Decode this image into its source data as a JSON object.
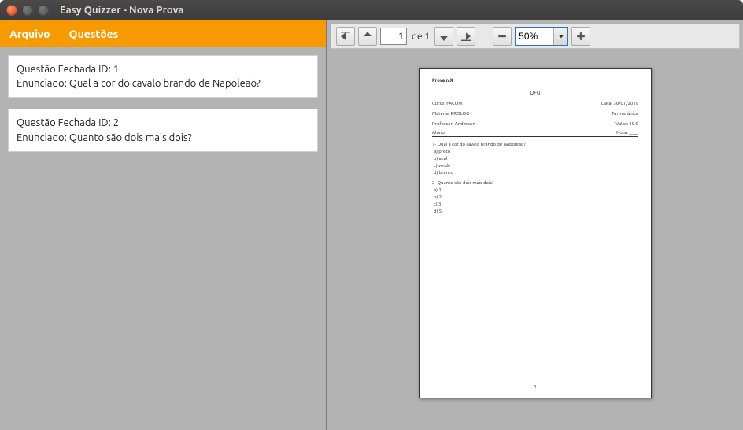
{
  "window": {
    "title": "Easy Quizzer - Nova Prova"
  },
  "menubar": {
    "arquivo": "Arquivo",
    "questoes": "Questões"
  },
  "questions": [
    {
      "id_line": "Questão Fechada ID: 1",
      "enun_line": "Enunciado: Qual a cor do cavalo brando de Napoleão?"
    },
    {
      "id_line": "Questão Fechada ID: 2",
      "enun_line": "Enunciado: Quanto são dois mais dois?"
    }
  ],
  "toolbar": {
    "page_value": "1",
    "page_of": "de 1",
    "zoom_value": "50%"
  },
  "preview": {
    "top_label": "Prova n.X",
    "university": "UFU",
    "curso": "Curso: FACOM",
    "data": "Data: 30/07/2019",
    "materia": "Matéria: PROLOG",
    "turma": "Turma: única",
    "professor": "Professor: Anderson",
    "valor": "Valor: 10.0",
    "aluno_label": "Aluno:",
    "nota_label": "Nota: ____",
    "q1": "1- Qual a cor do cavalo brando de Napoleão?",
    "q1_opts": [
      "a) preto",
      "b) azul",
      "c) verde",
      "d) branco"
    ],
    "q2": "2- Quanto são dois mais dois?",
    "q2_opts": [
      "a) 1",
      "b) 2",
      "c) 3",
      "d) 5"
    ],
    "page_num": "1"
  }
}
